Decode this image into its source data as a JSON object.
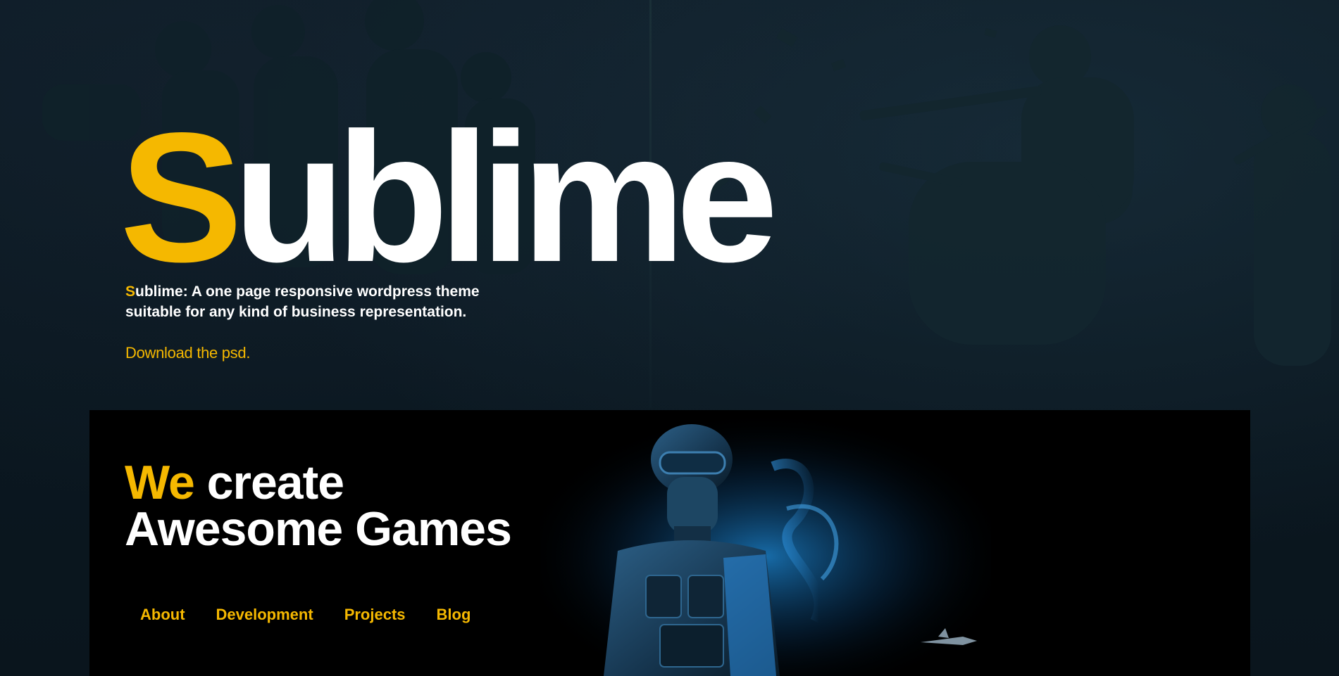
{
  "hero": {
    "brand_first_letter": "S",
    "brand_rest": "ublime",
    "tagline_first_letter": "S",
    "tagline_rest_line1": "ublime: A one page responsive wordpress theme",
    "tagline_line2": "suitable for any kind of business representation.",
    "download_label": "Download the psd."
  },
  "feature": {
    "heading_accent": "We",
    "heading_line1_rest": " create",
    "heading_line2": "Awesome Games"
  },
  "nav": {
    "items": [
      {
        "label": "About"
      },
      {
        "label": "Development"
      },
      {
        "label": "Projects"
      },
      {
        "label": "Blog"
      }
    ]
  },
  "colors": {
    "accent": "#f5b800",
    "text": "#ffffff",
    "background": "#0b1821",
    "panel": "#000000"
  },
  "images": {
    "hero_background": "soldiers-battle-silhouette",
    "feature_art": "armored-soldier-blue-smoke"
  }
}
